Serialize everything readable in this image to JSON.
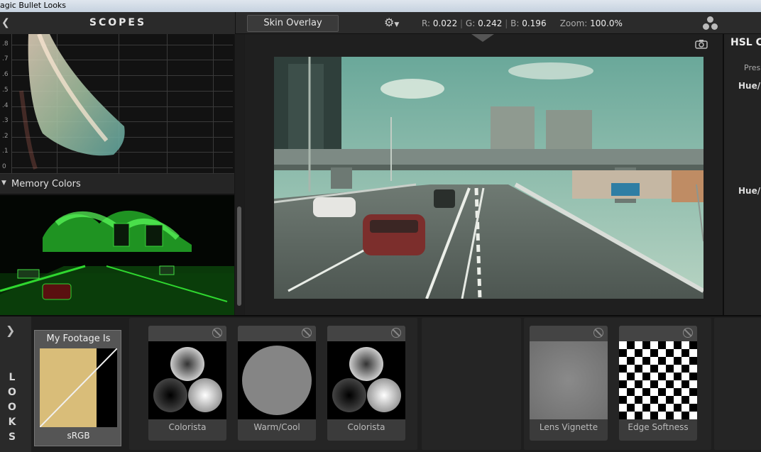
{
  "window": {
    "title": "agic Bullet Looks"
  },
  "scopes": {
    "title": "SCOPES",
    "y_ticks": [
      ".8",
      ".7",
      ".6",
      ".5",
      ".4",
      ".3",
      ".2",
      ".1",
      "0"
    ],
    "memory_colors_label": "Memory Colors"
  },
  "toolbar": {
    "skin_overlay_label": "Skin Overlay",
    "r_label": "R:",
    "r_value": "0.022",
    "g_label": "G:",
    "g_value": "0.242",
    "b_label": "B:",
    "b_value": "0.196",
    "zoom_label": "Zoom:",
    "zoom_value": "100.0%"
  },
  "right_panel": {
    "title": "HSL C",
    "preset_label": "Pres",
    "hue1_label": "Hue/S",
    "hue2_label": "Hue/L"
  },
  "looks": {
    "letters": [
      "L",
      "O",
      "O",
      "K",
      "S"
    ],
    "footage_title": "My Footage Is",
    "footage_label": "sRGB",
    "tools": [
      {
        "label": "Colorista"
      },
      {
        "label": "Warm/Cool"
      },
      {
        "label": "Colorista"
      },
      {
        "label": "Lens Vignette"
      },
      {
        "label": "Edge Softness"
      }
    ]
  },
  "colors": {
    "panel_bg": "#1b1b1b",
    "header_bg": "#2b2b2b",
    "footage_fill": "#d9bd79",
    "memory_green": "#3cff3c",
    "sky": "#9ec9b8"
  },
  "icons": {
    "collapse": "chevron-left-icon",
    "settings": "gear-icon",
    "camera": "camera-icon",
    "nodes": "nodes-icon",
    "expand_looks": "chevron-right-icon",
    "tool_disable": "disable-icon"
  }
}
